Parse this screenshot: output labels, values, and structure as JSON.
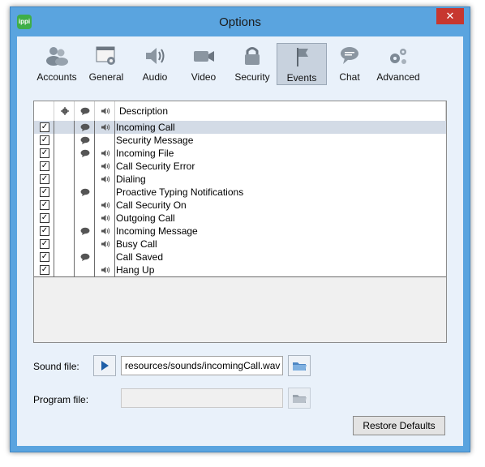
{
  "window": {
    "title": "Options",
    "app_icon_text": "ippi",
    "close_symbol": "✕"
  },
  "toolbar": {
    "items": [
      {
        "label": "Accounts",
        "icon": "accounts-icon"
      },
      {
        "label": "General",
        "icon": "general-icon"
      },
      {
        "label": "Audio",
        "icon": "audio-icon"
      },
      {
        "label": "Video",
        "icon": "video-icon"
      },
      {
        "label": "Security",
        "icon": "security-icon"
      },
      {
        "label": "Events",
        "icon": "flag-icon",
        "selected": true
      },
      {
        "label": "Chat",
        "icon": "chat-icon"
      },
      {
        "label": "Advanced",
        "icon": "advanced-icon"
      }
    ]
  },
  "events_table": {
    "columns": {
      "program": "program-gear-icon",
      "chat": "chat-bubble-icon",
      "sound": "speaker-icon",
      "description": "Description"
    },
    "rows": [
      {
        "checked": true,
        "chat": true,
        "sound": true,
        "description": "Incoming Call",
        "selected": true
      },
      {
        "checked": true,
        "chat": true,
        "sound": false,
        "description": "Security Message"
      },
      {
        "checked": true,
        "chat": true,
        "sound": true,
        "description": "Incoming File"
      },
      {
        "checked": true,
        "chat": false,
        "sound": true,
        "description": "Call Security Error"
      },
      {
        "checked": true,
        "chat": false,
        "sound": true,
        "description": "Dialing"
      },
      {
        "checked": true,
        "chat": true,
        "sound": false,
        "description": "Proactive Typing Notifications"
      },
      {
        "checked": true,
        "chat": false,
        "sound": true,
        "description": "Call Security On"
      },
      {
        "checked": true,
        "chat": false,
        "sound": true,
        "description": "Outgoing Call"
      },
      {
        "checked": true,
        "chat": true,
        "sound": true,
        "description": "Incoming Message"
      },
      {
        "checked": true,
        "chat": false,
        "sound": true,
        "description": "Busy Call"
      },
      {
        "checked": true,
        "chat": true,
        "sound": false,
        "description": "Call Saved"
      },
      {
        "checked": true,
        "chat": false,
        "sound": true,
        "description": "Hang Up"
      }
    ]
  },
  "sound_file": {
    "label": "Sound file:",
    "value": "resources/sounds/incomingCall.wav"
  },
  "program_file": {
    "label": "Program file:",
    "value": ""
  },
  "restore_defaults": {
    "label": "Restore Defaults"
  },
  "colors": {
    "frame": "#5aa4df",
    "client": "#e9f1fa",
    "close": "#c7372f",
    "selection": "#d3dbe6"
  }
}
